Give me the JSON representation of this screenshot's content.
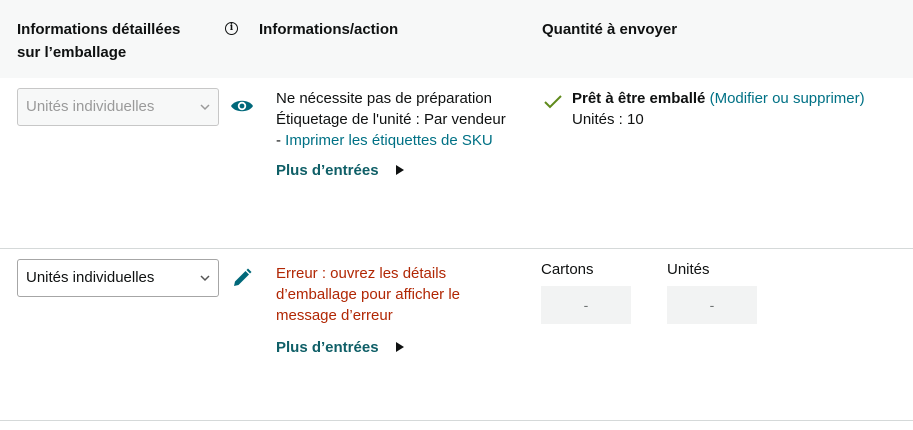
{
  "header": {
    "packing_details": "Informations détaillées\nsur l’emballage",
    "info_action": "Informations/action",
    "quantity": "Quantité à envoyer"
  },
  "rows": [
    {
      "packing_select": "Unités individuelles",
      "prep": "Ne nécessite pas de préparation",
      "labeling": "Étiquetage de l'unité : Par vendeur",
      "label_link_prefix": "- ",
      "label_link": "Imprimer les étiquettes de SKU",
      "more": "Plus d’entrées",
      "status": "Prêt à être emballé",
      "status_link": "(Modifier ou supprimer)",
      "units": "Unités : 10"
    },
    {
      "packing_select": "Unités individuelles",
      "error_line1": "Erreur : ouvrez les détails",
      "error_line2": "d’emballage pour afficher le",
      "error_line3": "message d’erreur",
      "more": "Plus d’entrées",
      "cartons_label": "Cartons",
      "units_label": "Unités",
      "cartons_value": "-",
      "units_value": "-"
    }
  ],
  "colors": {
    "accent": "#007185",
    "error": "#b12704",
    "check": "#5f8a1b",
    "icon_teal": "#00687a"
  },
  "icons": [
    "info-icon",
    "eye-icon",
    "pencil-icon",
    "chevron-down-icon",
    "checkmark-icon",
    "triangle-right-icon"
  ]
}
